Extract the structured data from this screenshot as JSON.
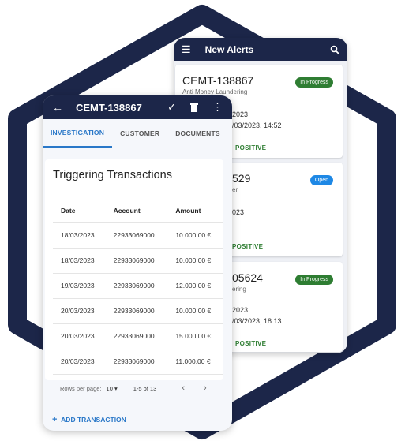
{
  "colors": {
    "navy": "#1c2649",
    "accent": "#2a78c8",
    "green": "#2e7d32",
    "blue": "#1e88e5"
  },
  "alerts": {
    "title": "New Alerts",
    "menu_icon": "menu-icon",
    "search_icon": "search-icon",
    "cards": [
      {
        "id": "CEMT-138867",
        "type": "Anti Money Laundering",
        "status": "In Progress",
        "line1": "2023",
        "line2": "/03/2023, 14:52",
        "result": "POSITIVE"
      },
      {
        "id": "529",
        "type": "er",
        "status": "Open",
        "line1": "023",
        "line2": "",
        "result": "POSITIVE"
      },
      {
        "id": "05624",
        "type": "ering",
        "status": "In Progress",
        "line1": "2023",
        "line2": "/03/2023, 18:13",
        "result": "POSITIVE"
      }
    ]
  },
  "detail": {
    "title": "CEMT-138867",
    "tabs": [
      "INVESTIGATION",
      "CUSTOMER",
      "DOCUMENTS"
    ],
    "active_tab": "INVESTIGATION",
    "section_title": "Triggering Transactions",
    "columns": [
      "Date",
      "Account",
      "Amount"
    ],
    "rows": [
      [
        "18/03/2023",
        "22933069000",
        "10.000,00 €"
      ],
      [
        "18/03/2023",
        "22933069000",
        "10.000,00 €"
      ],
      [
        "19/03/2023",
        "22933069000",
        "12.000,00 €"
      ],
      [
        "20/03/2023",
        "22933069000",
        "10.000,00 €"
      ],
      [
        "20/03/2023",
        "22933069000",
        "15.000,00 €"
      ],
      [
        "20/03/2023",
        "22933069000",
        "11.000,00 €"
      ]
    ],
    "pager": {
      "rows_label": "Rows per page:",
      "rows_value": "10",
      "range": "1-5 of 13"
    },
    "add_label": "ADD TRANSACTION"
  }
}
